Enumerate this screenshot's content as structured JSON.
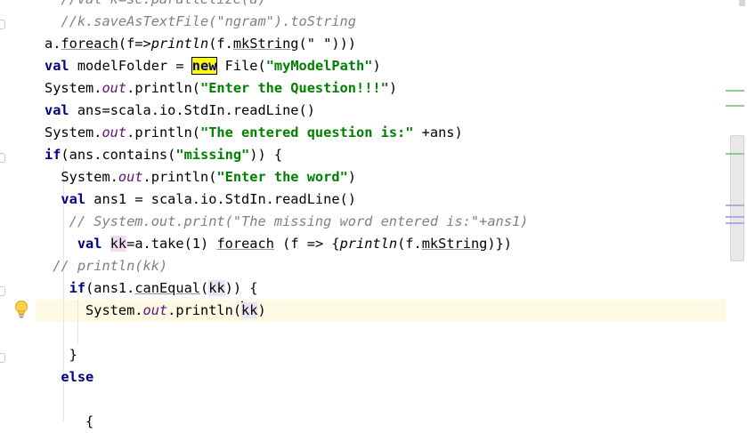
{
  "code": {
    "lines": [
      [
        {
          "t": "  //val k=sc.parallelize(a)",
          "c": "cmt"
        }
      ],
      [
        {
          "t": "  //k.saveAsTextFile(\"ngram\").toString",
          "c": "cmt"
        }
      ],
      [
        {
          "t": "a."
        },
        {
          "t": "foreach",
          "c": "und"
        },
        {
          "t": "(f=>"
        },
        {
          "t": "println",
          "c": "fn"
        },
        {
          "t": "(f."
        },
        {
          "t": "mkString",
          "c": "und"
        },
        {
          "t": "(\" \")))"
        }
      ],
      [
        {
          "t": "val",
          "c": "kw"
        },
        {
          "t": " modelFolder = "
        },
        {
          "t": "new",
          "c": "kw hlnew"
        },
        {
          "t": " File("
        },
        {
          "t": "\"myModelPath\"",
          "c": "str"
        },
        {
          "t": ")"
        }
      ],
      [
        {
          "t": "System."
        },
        {
          "t": "out",
          "c": "fld"
        },
        {
          "t": ".println("
        },
        {
          "t": "\"Enter the Question!!!\"",
          "c": "str"
        },
        {
          "t": ")"
        }
      ],
      [
        {
          "t": "val",
          "c": "kw"
        },
        {
          "t": " ans=scala.io.StdIn.readLine()"
        }
      ],
      [
        {
          "t": "System."
        },
        {
          "t": "out",
          "c": "fld"
        },
        {
          "t": ".println("
        },
        {
          "t": "\"The entered question is:\"",
          "c": "str"
        },
        {
          "t": " +ans)"
        }
      ],
      [
        {
          "t": "if",
          "c": "kw"
        },
        {
          "t": "(ans.contains("
        },
        {
          "t": "\"missing\"",
          "c": "str"
        },
        {
          "t": ")) {"
        }
      ],
      [
        {
          "t": "  System."
        },
        {
          "t": "out",
          "c": "fld"
        },
        {
          "t": ".println("
        },
        {
          "t": "\"Enter the word\"",
          "c": "str"
        },
        {
          "t": ")"
        }
      ],
      [
        {
          "t": "  "
        },
        {
          "t": "val",
          "c": "kw"
        },
        {
          "t": " ans1 = scala.io.StdIn.readLine()"
        }
      ],
      [
        {
          "t": "   // System.out.print(\"The missing word entered is:\"+ans1)",
          "c": "cmt"
        }
      ],
      [
        {
          "t": "    "
        },
        {
          "t": "val",
          "c": "kw"
        },
        {
          "t": " "
        },
        {
          "t": "kk",
          "c": "hlvar2"
        },
        {
          "t": "=a.take(1) "
        },
        {
          "t": "foreach",
          "c": "und"
        },
        {
          "t": " (f => {"
        },
        {
          "t": "println",
          "c": "fn"
        },
        {
          "t": "(f."
        },
        {
          "t": "mkString",
          "c": "und"
        },
        {
          "t": ")})"
        }
      ],
      [
        {
          "t": " // println(kk)",
          "c": "cmt"
        }
      ],
      [
        {
          "t": "   "
        },
        {
          "t": "if",
          "c": "kw"
        },
        {
          "t": "(ans1."
        },
        {
          "t": "canEqual",
          "c": "und"
        },
        {
          "t": "("
        },
        {
          "t": "kk",
          "c": "hlvar"
        },
        {
          "t": ")) {"
        }
      ],
      [
        {
          "t": "     System."
        },
        {
          "t": "out",
          "c": "fld"
        },
        {
          "t": ".println("
        },
        {
          "t": "kk",
          "c": "hlvar caret"
        },
        {
          "t": ")"
        }
      ],
      [
        {
          "t": ""
        }
      ],
      [
        {
          "t": "   }"
        }
      ],
      [
        {
          "t": "  "
        },
        {
          "t": "else",
          "c": "kw"
        }
      ],
      [
        {
          "t": ""
        }
      ],
      [
        {
          "t": "     {"
        }
      ]
    ]
  },
  "intention_icon": "lightbulb-icon",
  "colors": {
    "keyword": "#000080",
    "string": "#008000",
    "comment": "#808080",
    "field": "#660e7a",
    "caret_line": "#fffae3",
    "highlight_new": "#ffff00",
    "marker_added": "#8dcf8d",
    "marker_occurrence": "#b8a8e8"
  }
}
